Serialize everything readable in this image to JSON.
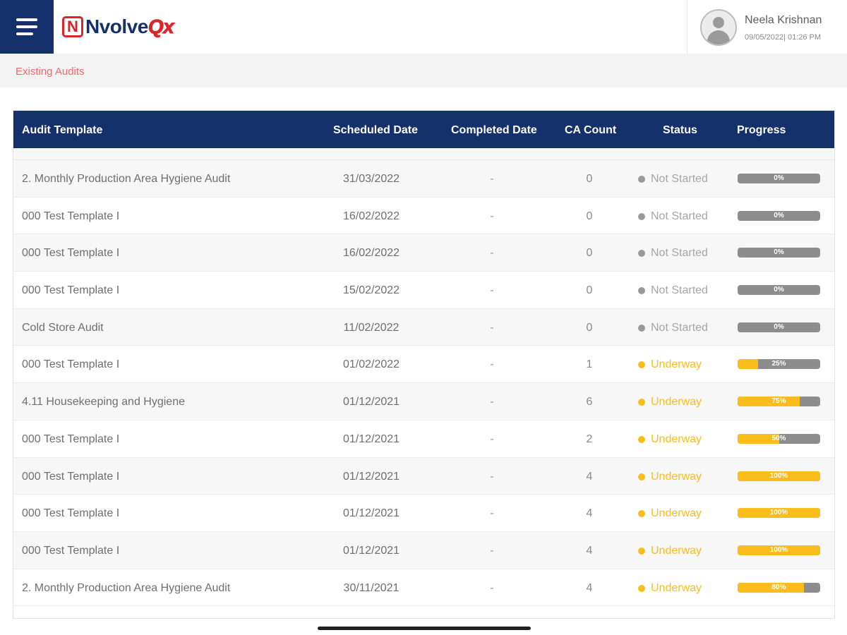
{
  "app": {
    "logo_mark": "N",
    "logo_main": "Nvolve",
    "logo_accent": "Qx"
  },
  "user": {
    "name": "Neela Krishnan",
    "datetime": "09/05/2022| 01:26 PM"
  },
  "breadcrumb": "Existing Audits",
  "table": {
    "headers": {
      "template": "Audit Template",
      "scheduled": "Scheduled Date",
      "completed": "Completed Date",
      "ca_count": "CA Count",
      "status": "Status",
      "progress": "Progress"
    },
    "rows": [
      {
        "template": "2. Monthly Production Area Hygiene Audit",
        "scheduled": "31/03/2022",
        "completed": "-",
        "ca_count": "0",
        "status": "Not Started",
        "progress": 0,
        "progress_label": "0%"
      },
      {
        "template": "000 Test Template I",
        "scheduled": "16/02/2022",
        "completed": "-",
        "ca_count": "0",
        "status": "Not Started",
        "progress": 0,
        "progress_label": "0%"
      },
      {
        "template": "000 Test Template I",
        "scheduled": "16/02/2022",
        "completed": "-",
        "ca_count": "0",
        "status": "Not Started",
        "progress": 0,
        "progress_label": "0%"
      },
      {
        "template": "000 Test Template I",
        "scheduled": "15/02/2022",
        "completed": "-",
        "ca_count": "0",
        "status": "Not Started",
        "progress": 0,
        "progress_label": "0%"
      },
      {
        "template": "Cold Store Audit",
        "scheduled": "11/02/2022",
        "completed": "-",
        "ca_count": "0",
        "status": "Not Started",
        "progress": 0,
        "progress_label": "0%"
      },
      {
        "template": "000 Test Template I",
        "scheduled": "01/02/2022",
        "completed": "-",
        "ca_count": "1",
        "status": "Underway",
        "progress": 25,
        "progress_label": "25%"
      },
      {
        "template": "4.11 Housekeeping and Hygiene",
        "scheduled": "01/12/2021",
        "completed": "-",
        "ca_count": "6",
        "status": "Underway",
        "progress": 75,
        "progress_label": "75%"
      },
      {
        "template": "000 Test Template I",
        "scheduled": "01/12/2021",
        "completed": "-",
        "ca_count": "2",
        "status": "Underway",
        "progress": 50,
        "progress_label": "50%"
      },
      {
        "template": "000 Test Template I",
        "scheduled": "01/12/2021",
        "completed": "-",
        "ca_count": "4",
        "status": "Underway",
        "progress": 100,
        "progress_label": "100%"
      },
      {
        "template": "000 Test Template I",
        "scheduled": "01/12/2021",
        "completed": "-",
        "ca_count": "4",
        "status": "Underway",
        "progress": 100,
        "progress_label": "100%"
      },
      {
        "template": "000 Test Template I",
        "scheduled": "01/12/2021",
        "completed": "-",
        "ca_count": "4",
        "status": "Underway",
        "progress": 100,
        "progress_label": "100%"
      },
      {
        "template": "2. Monthly Production Area Hygiene Audit",
        "scheduled": "30/11/2021",
        "completed": "-",
        "ca_count": "4",
        "status": "Underway",
        "progress": 80,
        "progress_label": "80%"
      }
    ]
  },
  "colors": {
    "brand_navy": "#15316b",
    "brand_red": "#d9262c",
    "breadcrumb": "#ef6b6b",
    "not_started": "#9a9a9a",
    "underway": "#fbbd1b",
    "progress_track": "#8d8d8d",
    "progress_fill": "#fbbd1b"
  },
  "icons": {
    "menu": "hamburger-menu-icon",
    "avatar": "user-avatar-icon"
  }
}
